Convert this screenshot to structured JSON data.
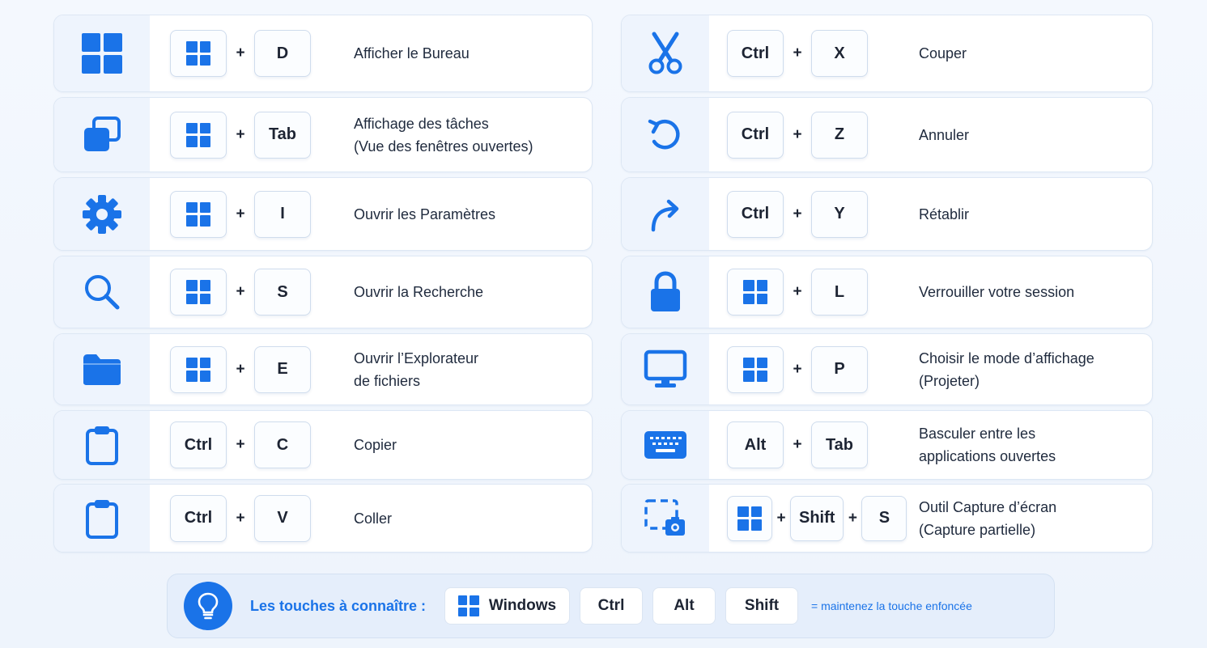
{
  "colors": {
    "accent": "#1a73e8",
    "icon_bg": "#eef4fd",
    "card_bg": "#ffffff",
    "footer_bg": "#e5eefb"
  },
  "left_shortcuts": [
    {
      "icon": "windows-logo-icon",
      "keys": [
        "win",
        "D"
      ],
      "desc": [
        "Afficher le Bureau"
      ]
    },
    {
      "icon": "task-view-icon",
      "keys": [
        "win",
        "Tab"
      ],
      "desc": [
        "Affichage des tâches",
        "(Vue des fenêtres ouvertes)"
      ]
    },
    {
      "icon": "gear-icon",
      "keys": [
        "win",
        "I"
      ],
      "desc": [
        "Ouvrir les Paramètres"
      ]
    },
    {
      "icon": "search-icon",
      "keys": [
        "win",
        "S"
      ],
      "desc": [
        "Ouvrir la Recherche"
      ]
    },
    {
      "icon": "folder-icon",
      "keys": [
        "win",
        "E"
      ],
      "desc": [
        "Ouvrir l’Explorateur",
        "de fichiers"
      ]
    },
    {
      "icon": "clipboard-icon",
      "keys": [
        "Ctrl",
        "C"
      ],
      "desc": [
        "Copier"
      ]
    },
    {
      "icon": "clipboard-icon",
      "keys": [
        "Ctrl",
        "V"
      ],
      "desc": [
        "Coller"
      ]
    }
  ],
  "right_shortcuts": [
    {
      "icon": "scissors-icon",
      "keys": [
        "Ctrl",
        "X"
      ],
      "desc": [
        "Couper"
      ]
    },
    {
      "icon": "undo-icon",
      "keys": [
        "Ctrl",
        "Z"
      ],
      "desc": [
        "Annuler"
      ]
    },
    {
      "icon": "redo-icon",
      "keys": [
        "Ctrl",
        "Y"
      ],
      "desc": [
        "Rétablir"
      ]
    },
    {
      "icon": "lock-icon",
      "keys": [
        "win",
        "L"
      ],
      "desc": [
        "Verrouiller votre session"
      ]
    },
    {
      "icon": "monitor-icon",
      "keys": [
        "win",
        "P"
      ],
      "desc": [
        "Choisir le mode d’affichage",
        "(Projeter)"
      ]
    },
    {
      "icon": "keyboard-icon",
      "keys": [
        "Alt",
        "Tab"
      ],
      "desc": [
        "Basculer entre les",
        "applications ouvertes"
      ]
    },
    {
      "icon": "screenshot-icon",
      "keys": [
        "win",
        "Shift",
        "S"
      ],
      "desc": [
        "Outil Capture d’écran",
        "(Capture partielle)"
      ]
    }
  ],
  "plus": "+",
  "footer": {
    "icon": "lightbulb-icon",
    "label": "Les touches à connaître :",
    "keys": [
      "Windows",
      "Ctrl",
      "Alt",
      "Shift"
    ],
    "note": "= maintenez la touche enfoncée"
  }
}
